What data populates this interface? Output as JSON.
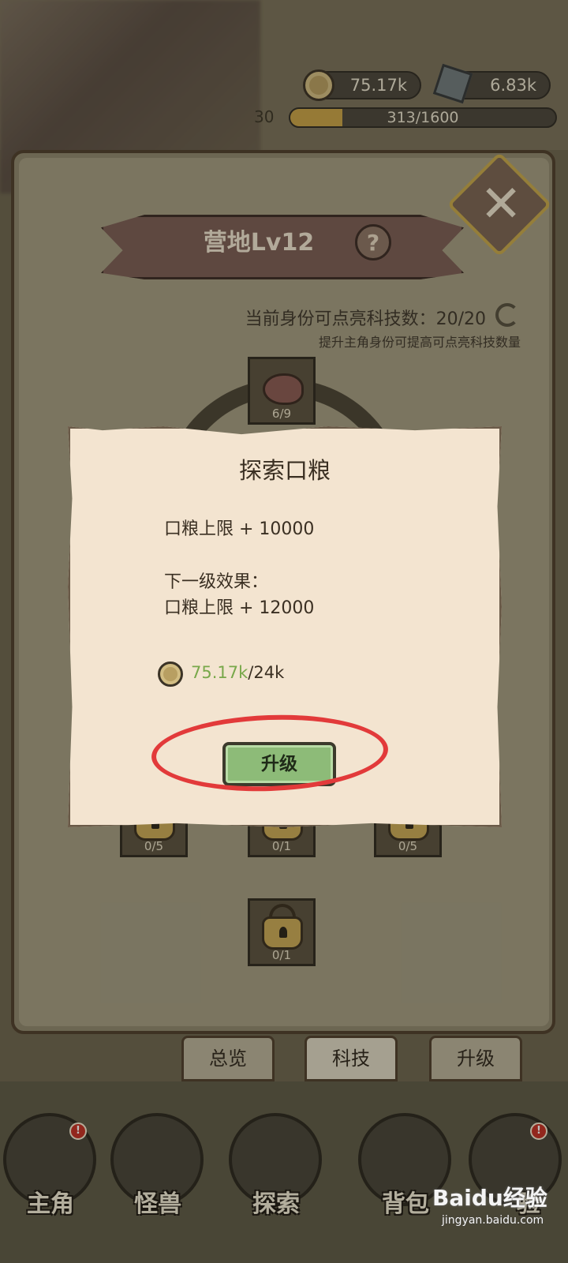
{
  "hud": {
    "coins": "75.17k",
    "gems": "6.83k",
    "level_trail": "30",
    "xp_text": "313/1600",
    "xp_progress": 0.196
  },
  "panel": {
    "title": "营地Lv12",
    "help": "?",
    "tech_count_label": "当前身份可点亮科技数：20/20",
    "tech_hint": "提升主角身份可提高可点亮科技数量"
  },
  "tech_nodes": [
    {
      "count": "6/9",
      "icon": "meat-icon"
    },
    {
      "count": "0/5",
      "icon": "lock-icon"
    },
    {
      "count": "0/1",
      "icon": "lock-icon"
    },
    {
      "count": "0/5",
      "icon": "lock-icon"
    },
    {
      "count": "0/1",
      "icon": "lock-icon"
    }
  ],
  "tabs": [
    {
      "label": "总览",
      "active": false
    },
    {
      "label": "科技",
      "active": true
    },
    {
      "label": "升级",
      "active": false
    }
  ],
  "nav": [
    {
      "label": "主角",
      "icon": "helmet-icon",
      "badge": "!"
    },
    {
      "label": "怪兽",
      "icon": "monster-eye-icon",
      "badge": ""
    },
    {
      "label": "探索",
      "icon": "map-scroll-icon",
      "badge": ""
    },
    {
      "label": "背包",
      "icon": "backpack-icon",
      "badge": ""
    },
    {
      "label": "验",
      "icon": "book-icon",
      "badge": "!"
    }
  ],
  "dialog": {
    "title": "探索口粮",
    "current_effect": "口粮上限 + 10000",
    "next_label": "下一级效果：",
    "next_effect": "口粮上限 + 12000",
    "cost_have": "75.17k",
    "cost_need": "/24k",
    "upgrade_label": "升级"
  },
  "watermark": {
    "brand": "Baidu经验",
    "url": "jingyan.baidu.com"
  },
  "colors": {
    "accent_gold": "#c8a347",
    "button_green": "#8dbb78",
    "cost_green": "#78a84a",
    "highlight_red": "#e23a3a"
  }
}
